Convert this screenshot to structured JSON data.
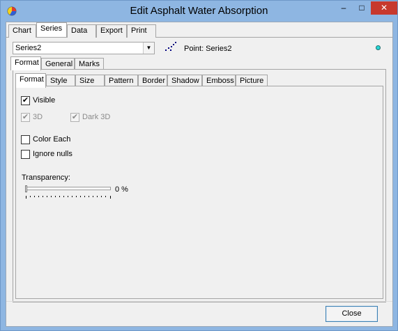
{
  "window": {
    "title": "Edit Asphalt Water Absorption",
    "app_icon": "teechart-icon",
    "controls": {
      "minimize": "–",
      "maximize": "□",
      "close": "✕"
    }
  },
  "main_tabs": {
    "items": [
      "Chart",
      "Series",
      "Data",
      "Export",
      "Print"
    ],
    "active": "Series"
  },
  "series_selector": {
    "value": "Series2",
    "icon": "chevron-down-icon"
  },
  "point_label": "Point: Series2",
  "series_color": "#28d7d7",
  "series_tabs": {
    "items": [
      "Format",
      "General",
      "Marks"
    ],
    "active": "Format"
  },
  "format_tabs": {
    "items": [
      "Format",
      "Style",
      "Size",
      "Pattern",
      "Border",
      "Shadow",
      "Emboss",
      "Picture"
    ],
    "active": "Format"
  },
  "options": {
    "visible": {
      "label": "Visible",
      "checked": true,
      "enabled": true
    },
    "three_d": {
      "label": "3D",
      "checked": true,
      "enabled": false
    },
    "dark_3d": {
      "label": "Dark 3D",
      "checked": true,
      "enabled": false
    },
    "color_each": {
      "label": "Color Each",
      "checked": false,
      "enabled": true
    },
    "ignore_nulls": {
      "label": "Ignore nulls",
      "checked": false,
      "enabled": true
    }
  },
  "transparency": {
    "label": "Transparency:",
    "value_text": "0 %",
    "value": 0
  },
  "footer": {
    "close_label": "Close"
  }
}
